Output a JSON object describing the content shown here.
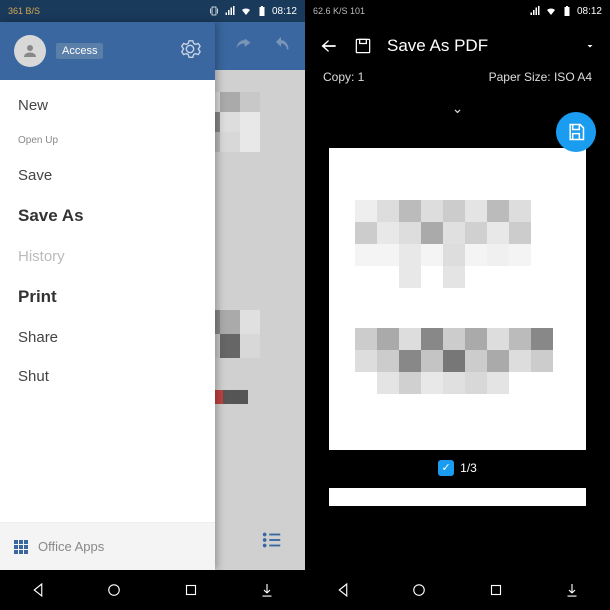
{
  "left": {
    "statusbar": {
      "speed": "361 B/S",
      "time": "08:12"
    },
    "drawer": {
      "access": "Access",
      "menu": {
        "new": "New",
        "open": "Open Up",
        "save": "Save",
        "saveas": "Save As",
        "history": "History",
        "print": "Print",
        "share": "Share",
        "shut": "Shut"
      },
      "footer": "Office Apps"
    }
  },
  "right": {
    "statusbar": {
      "speed": "62.6 K/S 101",
      "time": "08:12"
    },
    "title": "Save As PDF",
    "copy_label": "Copy: 1",
    "paper_label": "Paper Size: ISO A4",
    "page_counter": "1/3"
  }
}
